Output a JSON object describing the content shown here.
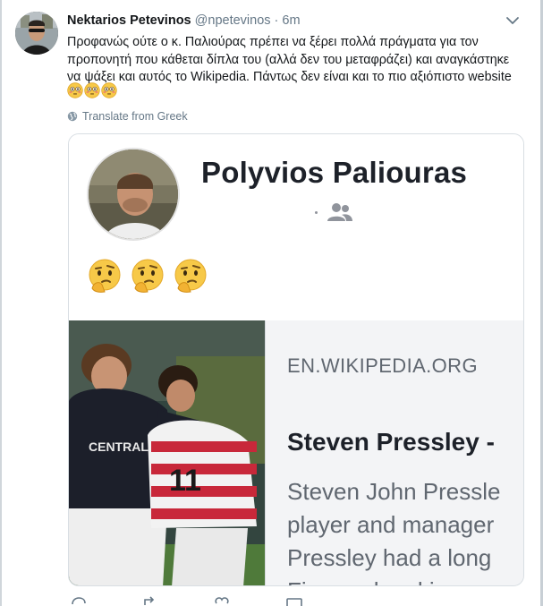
{
  "tweet": {
    "author_name": "Nektarios Petevinos",
    "handle": "@npetevinos",
    "separator": "·",
    "time": "6m",
    "text": "Προφανώς ούτε ο κ. Παλιούρας πρέπει να ξέρει πολλά πράγματα για τον προπονητή που κάθεται δίπλα του (αλλά δεν του μεταφράζει) και αναγκάστηκε να ψάξει και αυτός το Wikipedia. Πάντως δεν είναι και το πιο αξιόπιστο website",
    "trailing_emojis": [
      "flushed-face",
      "flushed-face",
      "flushed-face"
    ],
    "translate_label": "Translate from Greek"
  },
  "card": {
    "profile_name": "Polyvios Paliouras",
    "profile_sub_dot": "·",
    "profile_emojis": [
      "thinking-face",
      "thinking-face",
      "thinking-face"
    ],
    "link_domain": "EN.WIKIPEDIA.ORG",
    "link_title": "Steven Pressley -",
    "link_desc_lines": [
      "Steven John Pressle",
      "player and manager",
      "Pressley had a long",
      "Firm and making ov"
    ],
    "shirt_sponsor": "CENTRAL",
    "shirt_number": "11"
  },
  "colors": {
    "text_primary": "#14171a",
    "text_secondary": "#657786",
    "card_border": "#d8dee3",
    "fb_text": "#1d2129",
    "fb_secondary": "#606770",
    "emoji_yellow": "#f7c948"
  }
}
